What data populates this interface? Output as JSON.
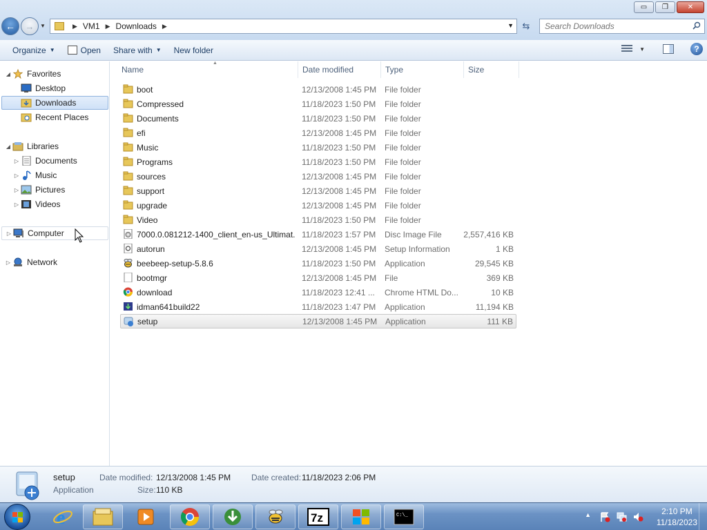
{
  "window": {
    "minimize": "▭",
    "restore": "❐",
    "close": "✕"
  },
  "address": {
    "crumbs": [
      "VM1",
      "Downloads"
    ]
  },
  "search": {
    "placeholder": "Search Downloads"
  },
  "toolbar": {
    "organize": "Organize",
    "open": "Open",
    "share_with": "Share with",
    "new_folder": "New folder"
  },
  "nav": {
    "favorites": "Favorites",
    "desktop": "Desktop",
    "downloads": "Downloads",
    "recent_places": "Recent Places",
    "libraries": "Libraries",
    "documents": "Documents",
    "music": "Music",
    "pictures": "Pictures",
    "videos": "Videos",
    "computer": "Computer",
    "network": "Network"
  },
  "columns": {
    "name": "Name",
    "date_modified": "Date modified",
    "type": "Type",
    "size": "Size"
  },
  "files": [
    {
      "name": "boot",
      "date": "12/13/2008 1:45 PM",
      "type": "File folder",
      "size": "",
      "icon": "folder-icon"
    },
    {
      "name": "Compressed",
      "date": "11/18/2023 1:50 PM",
      "type": "File folder",
      "size": "",
      "icon": "folder-icon"
    },
    {
      "name": "Documents",
      "date": "11/18/2023 1:50 PM",
      "type": "File folder",
      "size": "",
      "icon": "folder-icon"
    },
    {
      "name": "efi",
      "date": "12/13/2008 1:45 PM",
      "type": "File folder",
      "size": "",
      "icon": "folder-icon"
    },
    {
      "name": "Music",
      "date": "11/18/2023 1:50 PM",
      "type": "File folder",
      "size": "",
      "icon": "folder-icon"
    },
    {
      "name": "Programs",
      "date": "11/18/2023 1:50 PM",
      "type": "File folder",
      "size": "",
      "icon": "folder-icon"
    },
    {
      "name": "sources",
      "date": "12/13/2008 1:45 PM",
      "type": "File folder",
      "size": "",
      "icon": "folder-icon"
    },
    {
      "name": "support",
      "date": "12/13/2008 1:45 PM",
      "type": "File folder",
      "size": "",
      "icon": "folder-icon"
    },
    {
      "name": "upgrade",
      "date": "12/13/2008 1:45 PM",
      "type": "File folder",
      "size": "",
      "icon": "folder-icon"
    },
    {
      "name": "Video",
      "date": "11/18/2023 1:50 PM",
      "type": "File folder",
      "size": "",
      "icon": "folder-icon"
    },
    {
      "name": "7000.0.081212-1400_client_en-us_Ultimat...",
      "date": "11/18/2023 1:57 PM",
      "type": "Disc Image File",
      "size": "2,557,416 KB",
      "icon": "disc-image-icon"
    },
    {
      "name": "autorun",
      "date": "12/13/2008 1:45 PM",
      "type": "Setup Information",
      "size": "1 KB",
      "icon": "setup-info-icon"
    },
    {
      "name": "beebeep-setup-5.8.6",
      "date": "11/18/2023 1:50 PM",
      "type": "Application",
      "size": "29,545 KB",
      "icon": "beebeep-icon"
    },
    {
      "name": "bootmgr",
      "date": "12/13/2008 1:45 PM",
      "type": "File",
      "size": "369 KB",
      "icon": "file-icon"
    },
    {
      "name": "download",
      "date": "11/18/2023 12:41 ...",
      "type": "Chrome HTML Do...",
      "size": "10 KB",
      "icon": "chrome-icon"
    },
    {
      "name": "idman641build22",
      "date": "11/18/2023 1:47 PM",
      "type": "Application",
      "size": "11,194 KB",
      "icon": "idm-icon"
    },
    {
      "name": "setup",
      "date": "12/13/2008 1:45 PM",
      "type": "Application",
      "size": "111 KB",
      "icon": "setup-icon"
    }
  ],
  "details": {
    "name": "setup",
    "kind": "Application",
    "date_modified_label": "Date modified:",
    "date_modified": "12/13/2008 1:45 PM",
    "date_created_label": "Date created:",
    "date_created": "11/18/2023 2:06 PM",
    "size_label": "Size:",
    "size": "110 KB"
  },
  "clock": {
    "time": "2:10 PM",
    "date": "11/18/2023"
  },
  "taskbar_items": [
    "internet-explorer-icon",
    "windows-explorer-icon",
    "media-player-icon",
    "chrome-icon",
    "idm-icon",
    "beebeep-icon",
    "7zip-icon",
    "windows-logo-icon",
    "cmd-icon"
  ],
  "colors": {
    "selection": "#cfe1f7",
    "folder": "#e7c75a",
    "taskbar": "#6b92c4"
  }
}
